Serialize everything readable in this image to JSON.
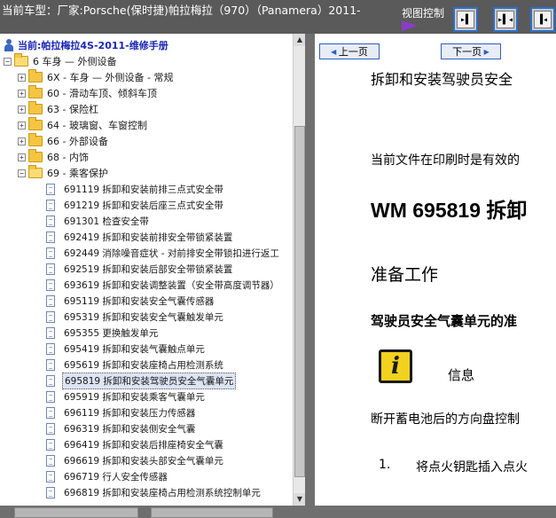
{
  "header": {
    "title": "当前车型：厂家:Porsche(保时捷)帕拉梅拉（970）（Panamera）2011-",
    "view_control_label": "视图控制",
    "view_buttons": [
      {
        "icon": "show-right-pane-icon",
        "glyph": "▸▌"
      },
      {
        "icon": "split-panes-icon",
        "glyph": "▸▌◂"
      },
      {
        "icon": "show-left-pane-icon",
        "glyph": "▐◂"
      }
    ]
  },
  "tree": {
    "root_label": "当前:帕拉梅拉4S-2011-维修手册",
    "section_label": "6 车身 — 外侧设备",
    "folders": [
      {
        "label": "6X - 车身 — 外侧设备 - 常规",
        "expander": "+"
      },
      {
        "label": "60 - 滑动车顶、倾斜车顶",
        "expander": "+"
      },
      {
        "label": "63 - 保险杠",
        "expander": "+"
      },
      {
        "label": "64 - 玻璃窗、车窗控制",
        "expander": "+"
      },
      {
        "label": "66 - 外部设备",
        "expander": "+"
      },
      {
        "label": "68 - 内饰",
        "expander": "+"
      },
      {
        "label": "69 - 乘客保护",
        "expander": "−"
      }
    ],
    "documents": [
      {
        "label": "691119 拆卸和安装前排三点式安全带"
      },
      {
        "label": "691219 拆卸和安装后座三点式安全带"
      },
      {
        "label": "691301 检查安全带"
      },
      {
        "label": "692419 拆卸和安装前排安全带锁紧装置"
      },
      {
        "label": "692449 消除噪音症状 - 对前排安全带锁扣进行返工"
      },
      {
        "label": "692519 拆卸和安装后部安全带锁紧装置"
      },
      {
        "label": "693619 拆卸和安装调整装置（安全带高度调节器）"
      },
      {
        "label": "695119 拆卸和安装安全气囊传感器"
      },
      {
        "label": "695319 拆卸和安装安全气囊触发单元"
      },
      {
        "label": "695355 更换触发单元"
      },
      {
        "label": "695419 拆卸和安装气囊触点单元"
      },
      {
        "label": "695619 拆卸和安装座椅占用检测系统"
      },
      {
        "label": "695819 拆卸和安装驾驶员安全气囊单元",
        "selected": true
      },
      {
        "label": "695919 拆卸和安装乘客气囊单元"
      },
      {
        "label": "696119 拆卸和安装压力传感器"
      },
      {
        "label": "696319 拆卸和安装侧安全气囊"
      },
      {
        "label": "696419 拆卸和安装后排座椅安全气囊"
      },
      {
        "label": "696619 拆卸和安装头部安全气囊单元"
      },
      {
        "label": "696719 行人安全传感器"
      },
      {
        "label": "696819 拆卸和安装座椅占用检测系统控制单元"
      }
    ]
  },
  "content": {
    "prev_label": "上一页",
    "next_label": "下一页",
    "heading": "拆卸和安装驾驶员安全",
    "validity_text": "当前文件在印刷时是有效的",
    "wm_title": "WM 695819 拆卸",
    "prep_heading": "准备工作",
    "sub_heading": "驾驶员安全气囊单元的准",
    "info_icon_glyph": "i",
    "info_label": "信息",
    "paragraph": "断开蓄电池后的方向盘控制",
    "step_number": "1.",
    "step_text": "将点火钥匙插入点火"
  },
  "colors": {
    "accent": "#2d5fbf",
    "root_label": "#1a26b8",
    "background": "#6f6f6f",
    "info_icon": "#f2d21e",
    "pointer": "#8b3cc7"
  }
}
